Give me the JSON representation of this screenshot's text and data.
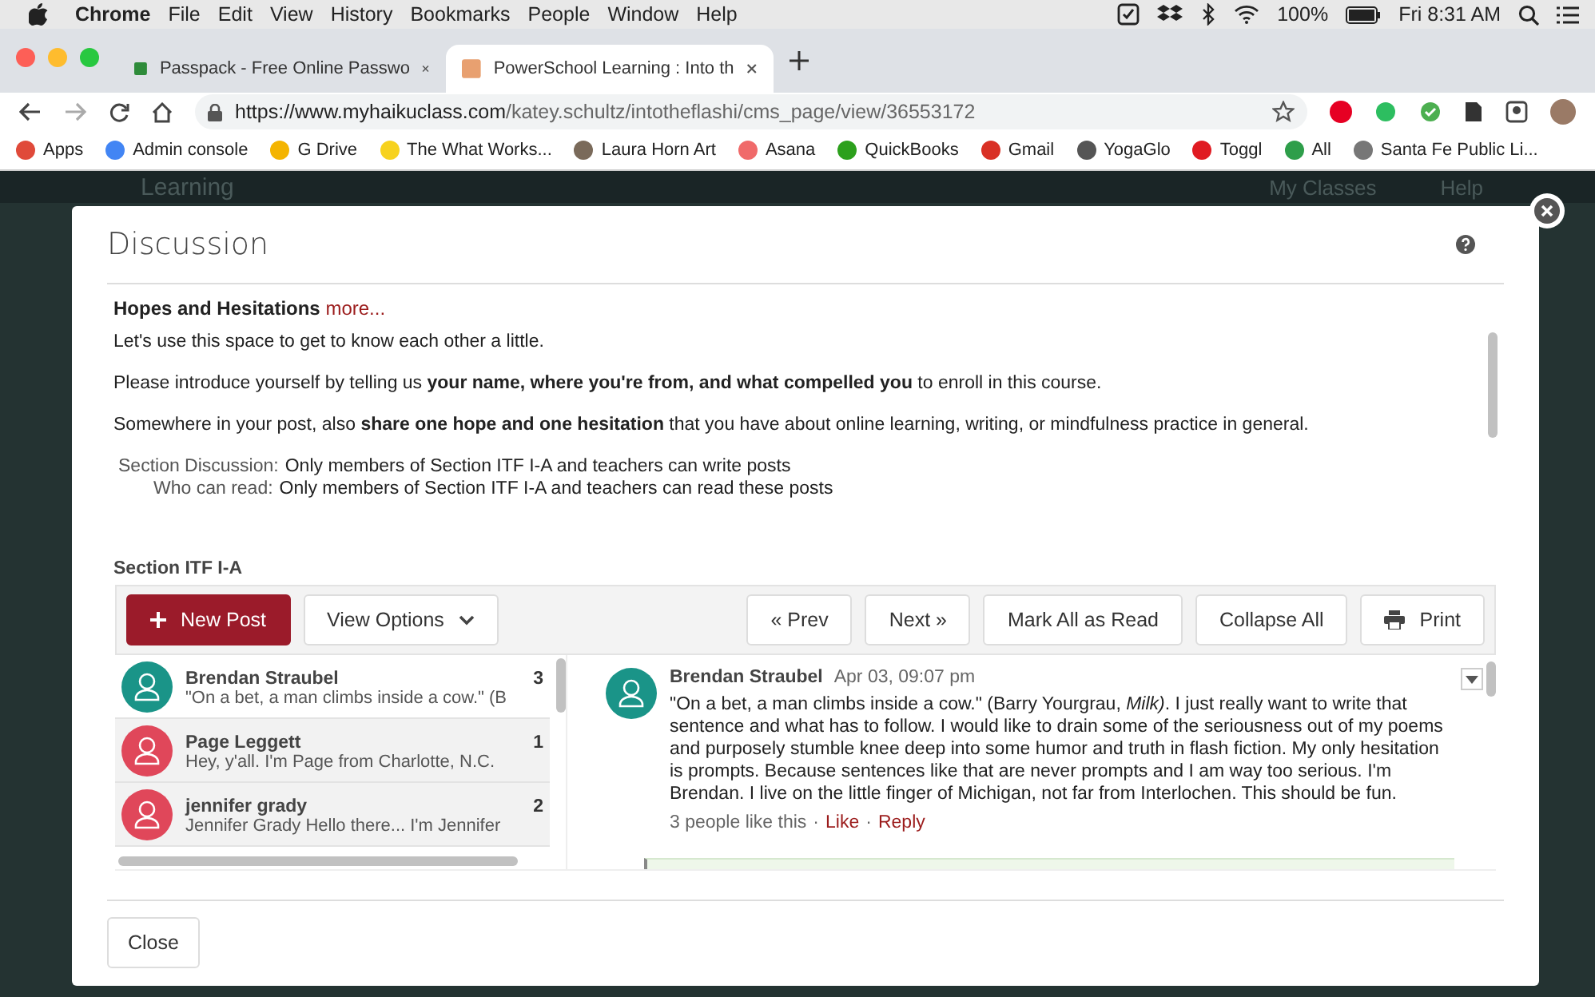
{
  "menubar": {
    "app": "Chrome",
    "menus": [
      "File",
      "Edit",
      "View",
      "History",
      "Bookmarks",
      "People",
      "Window",
      "Help"
    ],
    "battery": "100%",
    "clock": "Fri 8:31 AM"
  },
  "tabs": [
    {
      "title": "Passpack - Free Online Passwo",
      "selected": false,
      "color": "#2e8b3a"
    },
    {
      "title": "PowerSchool Learning : Into th",
      "selected": true,
      "color": "#e8a070"
    }
  ],
  "address": {
    "host": "https://www.myhaikuclass.com",
    "path": "/katey.schultz/intotheflashi/cms_page/view/36553172"
  },
  "bookmarks": [
    {
      "label": "Apps",
      "color": "#e04a3a"
    },
    {
      "label": "Admin console",
      "color": "#4285f4"
    },
    {
      "label": "G Drive",
      "color": "#f4b400"
    },
    {
      "label": "The What Works...",
      "color": "#f7d21e"
    },
    {
      "label": "Laura Horn Art",
      "color": "#7a6a5a"
    },
    {
      "label": "Asana",
      "color": "#f06a6a"
    },
    {
      "label": "QuickBooks",
      "color": "#2ca01c"
    },
    {
      "label": "Gmail",
      "color": "#d93025"
    },
    {
      "label": "YogaGlo",
      "color": "#555555"
    },
    {
      "label": "Toggl",
      "color": "#e01b22"
    },
    {
      "label": "All",
      "color": "#2e9e4a"
    },
    {
      "label": "Santa Fe Public Li...",
      "color": "#777777"
    }
  ],
  "background_page": {
    "logo": "Learning",
    "nav": [
      "My Classes",
      "Help"
    ]
  },
  "dialog": {
    "title": "Discussion",
    "topic": {
      "title": "Hopes and Hesitations",
      "more": "more..."
    },
    "paragraphs": [
      "Let's use this space to get to know each other a little.",
      "Please introduce yourself by telling us **your name, where you're from, and what compelled you** to enroll in this course.",
      "Somewhere in your post, also **share one hope and one hesitation** that you have about online learning, writing, or mindfulness practice in general."
    ],
    "permissions": [
      {
        "label": "Section Discussion:",
        "text": "Only members of Section ITF I-A and teachers can write posts"
      },
      {
        "label": "Who can read:",
        "text": "Only members of Section ITF I-A and teachers can read these posts"
      }
    ],
    "section": "Section ITF I-A",
    "toolbar": {
      "new_post": "New Post",
      "view_options": "View Options",
      "prev": "« Prev",
      "next": "Next »",
      "mark_all": "Mark All as Read",
      "collapse": "Collapse All",
      "print": "Print"
    },
    "posts": [
      {
        "author": "Brendan Straubel",
        "time": "3",
        "preview": "\"On a bet, a man climbs inside a cow.\" (B",
        "color": "#1a9488",
        "selected": true
      },
      {
        "author": "Page Leggett",
        "time": "1",
        "preview": "Hey, y'all. I'm Page from Charlotte, N.C.",
        "color": "#e0475a",
        "selected": false
      },
      {
        "author": "jennifer grady",
        "time": "2",
        "preview": "Jennifer Grady Hello there... I'm Jennifer",
        "color": "#e0475a",
        "selected": false
      }
    ],
    "thread": {
      "author": "Brendan Straubel",
      "date": "Apr 03, 09:07 pm",
      "color": "#1a9488",
      "body": "\"On a bet, a man climbs inside a cow.\" (Barry Yourgrau, *Milk)*.  I just really want to write that sentence and what has to follow.  I would like to drain some of the seriousness out of my poems and purposely stumble knee deep into some humor and truth in flash fiction. My only hesitation is prompts. Because sentences like that are never prompts and I am way too serious. I'm Brendan. I live on the little finger of Michigan, not far from Interlochen.  This should be fun.",
      "likes": "3 people like this",
      "separator": "·",
      "like": "Like",
      "reply": "Reply"
    },
    "close": "Close"
  }
}
